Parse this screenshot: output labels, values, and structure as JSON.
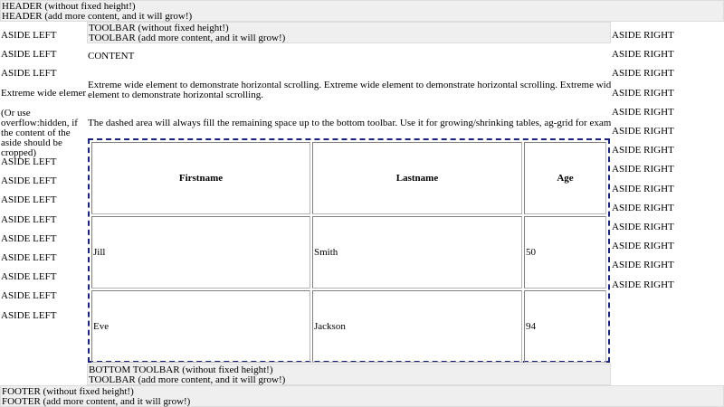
{
  "header": {
    "line1": "HEADER (without fixed height!)",
    "line2": "HEADER (add more content, and it will grow!)"
  },
  "toolbar": {
    "line1": "TOOLBAR (without fixed height!)",
    "line2": "TOOLBAR (add more content, and it will grow!)"
  },
  "aside_left": {
    "items": [
      "ASIDE LEFT",
      "ASIDE LEFT",
      "ASIDE LEFT",
      "Extreme wide element to demonstrate horizontal scrolling."
    ],
    "note": "(Or use overflow:hidden, if the content of the aside should be cropped)",
    "items_after": [
      "ASIDE LEFT",
      "ASIDE LEFT",
      "ASIDE LEFT",
      "ASIDE LEFT",
      "ASIDE LEFT",
      "ASIDE LEFT",
      "ASIDE LEFT",
      "ASIDE LEFT",
      "ASIDE LEFT"
    ]
  },
  "aside_right": {
    "items": [
      "ASIDE RIGHT",
      "ASIDE RIGHT",
      "ASIDE RIGHT",
      "ASIDE RIGHT",
      "ASIDE RIGHT",
      "ASIDE RIGHT",
      "ASIDE RIGHT",
      "ASIDE RIGHT",
      "ASIDE RIGHT",
      "ASIDE RIGHT",
      "ASIDE RIGHT",
      "ASIDE RIGHT",
      "ASIDE RIGHT",
      "ASIDE RIGHT"
    ]
  },
  "content": {
    "title": "CONTENT",
    "wide_text": "Extreme wide element to demonstrate horizontal scrolling. Extreme wide element to demonstrate horizontal scrolling. Extreme wide element to demonstrate horizontal scrolling.",
    "dashed_note": "The dashed area will always fill the remaining space up to the bottom toolbar. Use it for growing/shrinking tables, ag-grid for example.",
    "table": {
      "headers": [
        "Firstname",
        "Lastname",
        "Age"
      ],
      "rows": [
        [
          "Jill",
          "Smith",
          "50"
        ],
        [
          "Eve",
          "Jackson",
          "94"
        ]
      ]
    }
  },
  "bottom_toolbar": {
    "line1": "BOTTOM TOOLBAR (without fixed height!)",
    "line2": "TOOLBAR (add more content, and it will grow!)"
  },
  "footer": {
    "line1": "FOOTER (without fixed height!)",
    "line2": "FOOTER (add more content, and it will grow!)"
  },
  "colors": {
    "bar_background": "#efefef",
    "dashed_border": "#1a237e"
  }
}
